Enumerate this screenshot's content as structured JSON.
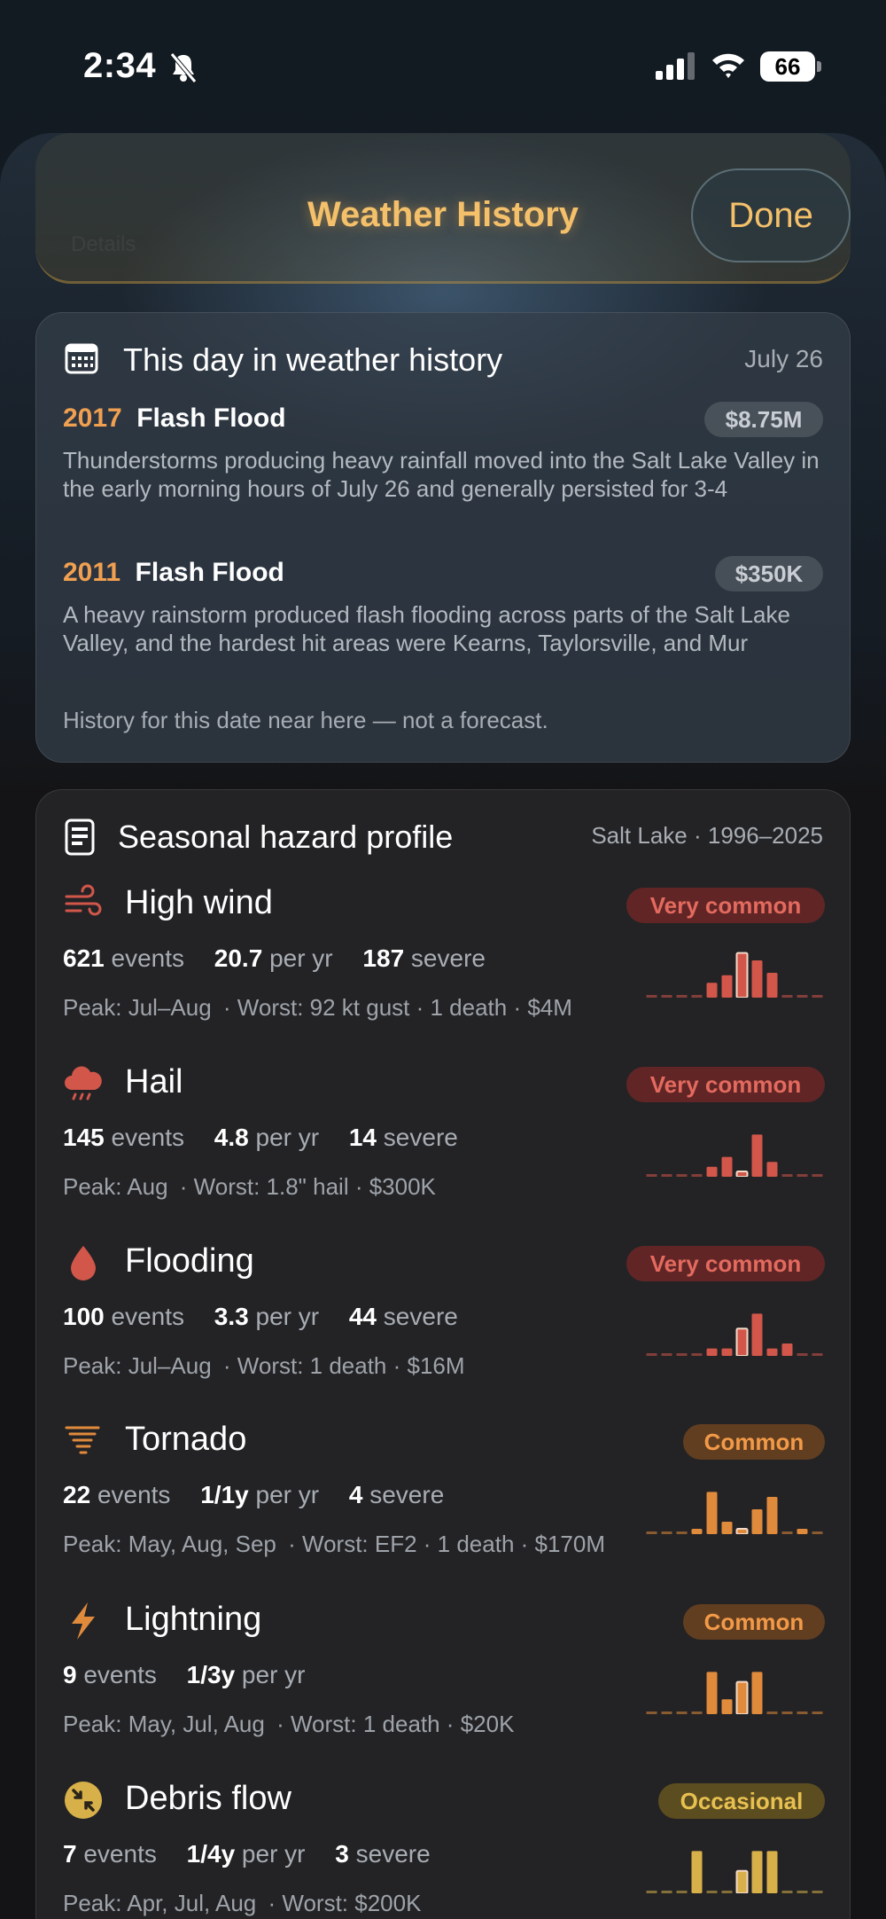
{
  "status_bar": {
    "time": "2:34",
    "battery": "66"
  },
  "header": {
    "title": "Weather History",
    "done_label": "Done",
    "ghost_text": [
      "Details"
    ]
  },
  "history": {
    "title": "This day in weather history",
    "date": "July 26",
    "events": [
      {
        "year": "2017",
        "title": "Flash Flood",
        "cost": "$8.75M",
        "desc": "Thunderstorms producing heavy rainfall moved into the Salt Lake Valley in the early morning hours of July 26 and generally persisted for 3-4"
      },
      {
        "year": "2011",
        "title": "Flash Flood",
        "cost": "$350K",
        "desc": "A heavy rainstorm produced flash flooding across parts of the Salt Lake Valley, and the hardest hit areas were Kearns, Taylorsville, and Mur"
      }
    ],
    "footnote": "History for this date near here — not a forecast."
  },
  "profile": {
    "title": "Seasonal hazard profile",
    "meta": "Salt Lake · 1996–2025",
    "events_word": "events",
    "per_yr_word": "per yr",
    "severe_word": "severe",
    "hazards": [
      {
        "name": "High wind",
        "icon": "wind-icon",
        "badge": "Very common",
        "color": "#d2564a",
        "events": "621",
        "per_yr": "20.7",
        "severe": "187",
        "peak": "Peak: Jul–Aug",
        "worst": "· Worst: 92 kt gust · 1 death · $4M",
        "monthly": [
          0.02,
          0.02,
          0.02,
          0.02,
          0.3,
          0.45,
          0.9,
          0.75,
          0.5,
          0.02,
          0.02,
          0.02
        ],
        "highlight": 6
      },
      {
        "name": "Hail",
        "icon": "hail-icon",
        "badge": "Very common",
        "color": "#d2564a",
        "events": "145",
        "per_yr": "4.8",
        "severe": "14",
        "peak": "Peak: Aug",
        "worst": "· Worst: 1.8\" hail · $300K",
        "monthly": [
          0.02,
          0.02,
          0.02,
          0.02,
          0.2,
          0.4,
          0.08,
          0.85,
          0.3,
          0.02,
          0.02,
          0.02
        ],
        "highlight": 6
      },
      {
        "name": "Flooding",
        "icon": "drop-icon",
        "badge": "Very common",
        "color": "#d2564a",
        "events": "100",
        "per_yr": "3.3",
        "severe": "44",
        "peak": "Peak: Jul–Aug",
        "worst": "· Worst: 1 death · $16M",
        "monthly": [
          0.02,
          0.02,
          0.02,
          0.02,
          0.15,
          0.15,
          0.55,
          0.85,
          0.15,
          0.25,
          0.02,
          0.02
        ],
        "highlight": 6
      },
      {
        "name": "Tornado",
        "icon": "tornado-icon",
        "badge": "Common",
        "color": "#e08a3c",
        "events": "22",
        "per_yr": "1/1y",
        "severe": "4",
        "peak": "Peak: May, Aug, Sep",
        "worst": "· Worst: EF2 · 1 death · $170M",
        "monthly": [
          0.02,
          0.02,
          0.02,
          0.1,
          0.85,
          0.25,
          0.1,
          0.5,
          0.75,
          0.02,
          0.1,
          0.02
        ],
        "highlight": 6
      },
      {
        "name": "Lightning",
        "icon": "bolt-icon",
        "badge": "Common",
        "color": "#e08a3c",
        "events": "9",
        "per_yr": "1/3y",
        "severe": "",
        "peak": "Peak: May, Jul, Aug",
        "worst": "· Worst: 1 death · $20K",
        "monthly": [
          0.02,
          0.02,
          0.02,
          0.02,
          0.85,
          0.3,
          0.65,
          0.85,
          0.02,
          0.02,
          0.02,
          0.02
        ],
        "highlight": 6
      },
      {
        "name": "Debris flow",
        "icon": "debris-icon",
        "badge": "Occasional",
        "color": "#d8b04a",
        "events": "7",
        "per_yr": "1/4y",
        "severe": "3",
        "peak": "Peak: Apr, Jul, Aug",
        "worst": "· Worst: $200K",
        "monthly": [
          0.02,
          0.02,
          0.02,
          0.85,
          0.02,
          0.02,
          0.45,
          0.85,
          0.85,
          0.02,
          0.02,
          0.02
        ],
        "highlight": 6
      }
    ]
  }
}
